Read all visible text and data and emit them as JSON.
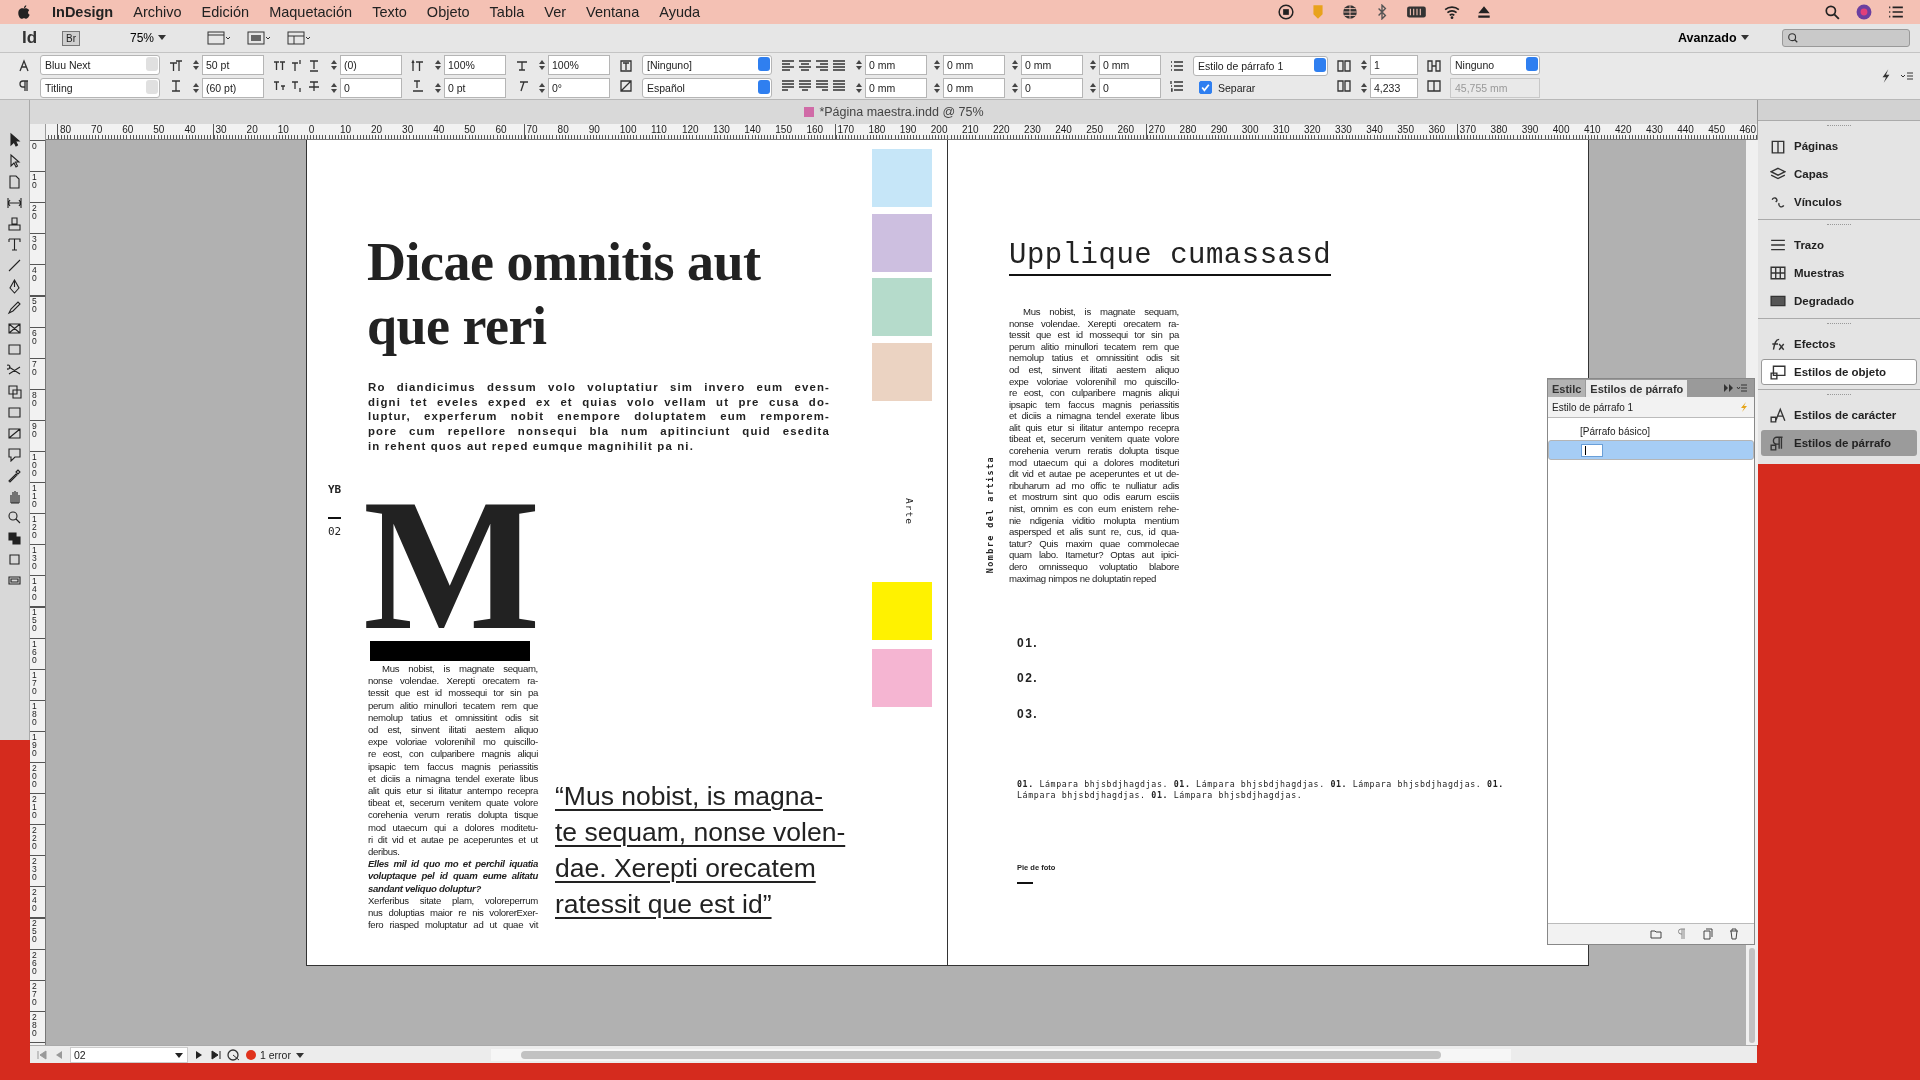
{
  "menu_bar": {
    "app": "InDesign",
    "items": [
      "Archivo",
      "Edición",
      "Maquetación",
      "Texto",
      "Objeto",
      "Tabla",
      "Ver",
      "Ventana",
      "Ayuda"
    ]
  },
  "app_bar": {
    "logo": "Id",
    "bridge": "Br",
    "zoom": "75%",
    "workspace": "Avanzado"
  },
  "control_panel": {
    "sections": [
      {
        "fields": [
          {
            "kind": "select",
            "value": "Bluu Next"
          },
          {
            "kind": "select",
            "value": "Titling"
          }
        ]
      },
      {
        "fields": [
          {
            "kind": "spin",
            "value": "50 pt"
          },
          {
            "kind": "spin",
            "value": "(60 pt)"
          }
        ]
      },
      {
        "fields": [
          {
            "kind": "spin",
            "value": "(0)"
          },
          {
            "kind": "spin",
            "value": "0"
          }
        ]
      },
      {
        "fields": [
          {
            "kind": "spin",
            "value": "100%"
          },
          {
            "kind": "spin",
            "value": "0 pt"
          }
        ]
      },
      {
        "fields": [
          {
            "kind": "spin",
            "value": "100%"
          },
          {
            "kind": "spin",
            "value": "0°"
          }
        ]
      },
      {
        "fields": [
          {
            "kind": "select",
            "value": "[Ninguno]"
          },
          {
            "kind": "select",
            "value": "Español"
          }
        ]
      },
      {
        "fields": [
          {
            "kind": "spin",
            "value": "0 mm"
          },
          {
            "kind": "spin",
            "value": "0 mm"
          }
        ]
      },
      {
        "fields": [
          {
            "kind": "spin",
            "value": "0 mm"
          },
          {
            "kind": "spin",
            "value": "0 mm"
          }
        ]
      },
      {
        "fields": [
          {
            "kind": "spin",
            "value": "0 mm"
          },
          {
            "kind": "spin",
            "value": "0"
          }
        ]
      },
      {
        "fields": [
          {
            "kind": "spin",
            "value": "0 mm"
          },
          {
            "kind": "spin",
            "value": "0"
          }
        ]
      },
      {
        "fields": [
          {
            "kind": "select",
            "value": "Estilo de párrafo 1"
          },
          {
            "kind": "checkbox",
            "value": "Separar",
            "checked": true
          }
        ]
      },
      {
        "fields": [
          {
            "kind": "spin",
            "value": "1"
          },
          {
            "kind": "spin",
            "value": "4,233"
          }
        ]
      },
      {
        "fields": [
          {
            "kind": "select",
            "value": "Ninguno"
          },
          {
            "kind": "readonly",
            "value": "45,755 mm"
          }
        ]
      }
    ]
  },
  "document": {
    "tab_title": "*Página maestra.indd @ 75%",
    "h_ruler": [
      "80",
      "70",
      "60",
      "50",
      "40",
      "30",
      "20",
      "10",
      "0",
      "10",
      "20",
      "30",
      "40",
      "50",
      "60",
      "70",
      "80",
      "90",
      "100",
      "110",
      "120",
      "130",
      "140",
      "150",
      "160",
      "170",
      "180",
      "190",
      "200",
      "210",
      "220",
      "230",
      "240",
      "250",
      "260",
      "270",
      "280",
      "290",
      "300",
      "310",
      "320",
      "330",
      "340",
      "350",
      "360",
      "370",
      "380",
      "390",
      "400",
      "410",
      "420",
      "430",
      "440",
      "450",
      "460"
    ],
    "v_ruler": [
      "0",
      "10",
      "20",
      "30",
      "40",
      "50",
      "60",
      "70",
      "80",
      "90",
      "100",
      "110",
      "120",
      "130",
      "140",
      "150",
      "160",
      "170",
      "180",
      "190",
      "200",
      "210",
      "220",
      "230",
      "240",
      "250",
      "260",
      "270",
      "280"
    ]
  },
  "left_page": {
    "title": "Dicae omnitis aut que reri",
    "intro": [
      "Ro diandicimus dessum volo voluptatiur sim invero eum even-",
      "digni tet eveles exped ex et quias volo vellam ut pre cusa do-",
      "luptur, experferum nobit enempore doluptatem eum remporem-",
      "pore cum repellore nonsequi bla num apitinciunt quid esedita",
      "in rehent quos aut reped eumque magnihilit pa ni."
    ],
    "folio": {
      "section": "YB",
      "number": "02"
    },
    "drop_cap": "M",
    "body": [
      {
        "kind": "regular",
        "lines": [
          "Mus nobist, is magnate sequam,",
          "nonse volendae. Xerepti orecatem ra-",
          "tessit que est id mossequi tor sin pa",
          "perum alitio minullori tecatem rem que",
          "nemolup tatius et omnissitint odis sit",
          "od est, sinvent ilitati aestem aliquo",
          "expe voloriae volorenihil mo quiscillo-",
          "re eost, con culparibere magnis aliqui",
          "ipsapic tem faccus magnis periassitis",
          "et diciis a nimagna tendel exerate libus",
          "alit quis etur si ilitatur antempo recepra",
          "tibeat et, secerum venitem quate volore",
          "corehenia verum reratis dolupta tisque",
          "mod utaecum qui a dolores moditetu-",
          "ri dit vid et autae pe aceperuntes et ut",
          "deribus."
        ]
      },
      {
        "kind": "emphasis",
        "lines": [
          "Elles mil id quo mo et perchil iquatia",
          "voluptaque pel id quam eume alitatu",
          "sandant veliquo doluptur?"
        ]
      },
      {
        "kind": "regular",
        "lines": [
          "Xerferibus sitate plam, voloreperrum",
          "nus doluptias maior re nis volorerExer-",
          "fero riasped moluptatur ad ut quae vit"
        ]
      }
    ],
    "swatches": [
      {
        "color": "#c6e6f8"
      },
      {
        "color": "#cdbfe0"
      },
      {
        "color": "#b5dbcb"
      },
      {
        "color": "#ebd3c2"
      },
      {
        "color": "#fff200"
      },
      {
        "color": "#f5b5d2"
      }
    ],
    "side_label": "Arte",
    "pull_quote": [
      "“Mus nobist, is magna-",
      "te sequam, nonse volen-",
      "dae. Xerepti orecatem",
      "ratessit que est id”"
    ]
  },
  "right_page": {
    "heading": "Upplique cumassasd",
    "side_label": "Nombre del artista",
    "body": [
      "Mus nobist, is magnate sequam,",
      "nonse volendae. Xerepti orecatem ra-",
      "tessit que est id mossequi tor sin pa",
      "perum alitio minullori tecatem rem que",
      "nemolup tatius et omnissitint odis sit",
      "od est, sinvent ilitati aestem aliquo",
      "expe voloriae volorenihil mo quiscillo-",
      "re eost, con culparibere magnis aliqui",
      "ipsapic tem faccus magnis periassitis",
      "et diciis a nimagna tendel exerate libus",
      "alit quis etur si ilitatur antempo recepra",
      "tibeat et, secerum venitem quate volore",
      "corehenia verum reratis dolupta tisque",
      "mod utaecum qui a dolores moditeturi",
      "dit vid et autae pe aceperuntes et ut de-",
      "ribuharum ad mo offic te nulliatur adis",
      "et mostrum sint quo odis earum esciis",
      "nist, omnim es con eum enistem rehe-",
      "nie ndigenia viditio molupta mentium",
      "aspersped et alis sunt re, cus, id qua-",
      "tatur? Quis maxim quae commolecae",
      "quam labo. Itametur? Optas aut ipici-",
      "dero omnissequo voluptatio blabore",
      "maximag nimpos ne doluptatin reped"
    ],
    "numbers": [
      "01.",
      "02.",
      "03."
    ],
    "captions": [
      "**01.** Lámpara bhjsbdjhagdjas. **01.** Lámpara bhjsbdjhagdjas. **01.** Lámpara bhjsbdjhagdjas. **01.**",
      "Lámpara bhjsbdjhagdjas. **01.** Lámpara bhjsbdjhagdjas."
    ],
    "photo_caption": "Pie de foto"
  },
  "panel_dock": {
    "groups": [
      [
        {
          "label": "Páginas",
          "selected": false,
          "outlined": false
        },
        {
          "label": "Capas",
          "selected": false,
          "outlined": false
        },
        {
          "label": "Vínculos",
          "selected": false,
          "outlined": false
        }
      ],
      [
        {
          "label": "Trazo",
          "selected": false,
          "outlined": false
        },
        {
          "label": "Muestras",
          "selected": false,
          "outlined": false
        },
        {
          "label": "Degradado",
          "selected": false,
          "outlined": false
        }
      ],
      [
        {
          "label": "Efectos",
          "selected": false,
          "outlined": false
        },
        {
          "label": "Estilos de objeto",
          "selected": false,
          "outlined": true
        }
      ],
      [
        {
          "label": "Estilos de carácter",
          "selected": false,
          "outlined": false
        },
        {
          "label": "Estilos de párrafo",
          "selected": true,
          "outlined": false
        }
      ]
    ]
  },
  "styles_panel": {
    "tabs": [
      {
        "label": "Estilc",
        "selected": false
      },
      {
        "label": "Estilos de párrafo",
        "selected": true
      }
    ],
    "current": "Estilo de párrafo 1",
    "items": [
      {
        "label": "[Párrafo básico]",
        "selected": false,
        "editing": false
      },
      {
        "selected": true,
        "editing": true
      }
    ]
  },
  "status_bar": {
    "page": "02",
    "errors": "1 error"
  }
}
